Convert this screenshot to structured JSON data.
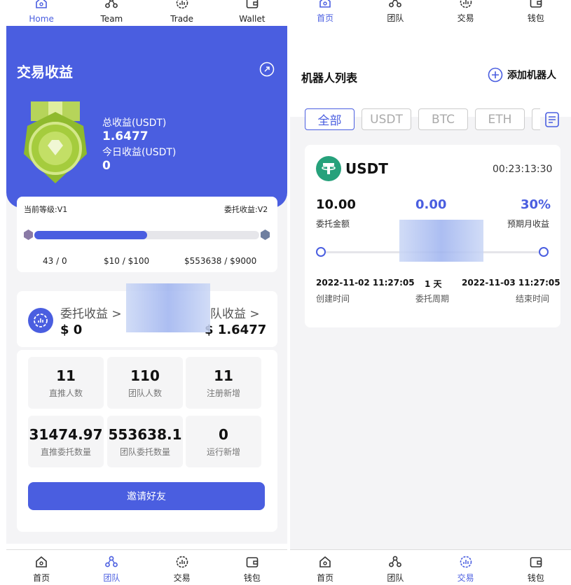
{
  "left": {
    "top_nav": [
      {
        "label": "Home",
        "icon": "home-icon",
        "active": true
      },
      {
        "label": "Team",
        "icon": "team-icon",
        "active": false
      },
      {
        "label": "Trade",
        "icon": "trade-icon",
        "active": false
      },
      {
        "label": "Wallet",
        "icon": "wallet-icon",
        "active": false
      }
    ],
    "hero": {
      "title": "交易收益",
      "total_label": "总收益(USDT)",
      "total_value": "1.6477",
      "today_label": "今日收益(USDT)",
      "today_value": "0"
    },
    "level": {
      "current": "当前等级:V1",
      "commission": "委托收益:V2",
      "progress": 0.5,
      "stats": [
        "43 / 0",
        "$10 / $100",
        "$553638 / $9000"
      ]
    },
    "earnings": {
      "left_label": "委托收益 >",
      "left_value": "$ 0",
      "right_label": "队收益 >",
      "right_value": "$ 1.6477"
    },
    "grid": [
      {
        "value": "11",
        "label": "直推人数"
      },
      {
        "value": "110",
        "label": "团队人数"
      },
      {
        "value": "11",
        "label": "注册新增"
      },
      {
        "value": "31474.97",
        "label": "直推委托数量"
      },
      {
        "value": "553638.1",
        "label": "团队委托数量"
      },
      {
        "value": "0",
        "label": "运行新增"
      }
    ],
    "invite_label": "邀请好友",
    "bottom_nav": [
      {
        "label": "首页",
        "icon": "home-icon",
        "active": false
      },
      {
        "label": "团队",
        "icon": "team-icon",
        "active": true
      },
      {
        "label": "交易",
        "icon": "trade-icon",
        "active": false
      },
      {
        "label": "钱包",
        "icon": "wallet-icon",
        "active": false
      }
    ]
  },
  "right": {
    "top_nav": [
      {
        "label": "首页",
        "icon": "home-icon",
        "active": true
      },
      {
        "label": "团队",
        "icon": "team-icon",
        "active": false
      },
      {
        "label": "交易",
        "icon": "trade-icon",
        "active": false
      },
      {
        "label": "钱包",
        "icon": "wallet-icon",
        "active": false
      }
    ],
    "title": "机器人列表",
    "add_label": "添加机器人",
    "filters": [
      "全部",
      "USDT",
      "BTC",
      "ETH"
    ],
    "robot": {
      "coin": "USDT",
      "time": "00:23:13:30",
      "amount": "10.00",
      "amount_label": "委托金额",
      "profit": "0.00",
      "monthly": "30%",
      "monthly_label": "预期月收益",
      "start": "2022-11-02 11:27:05",
      "start_label": "创建时间",
      "period": "1 天",
      "period_label": "委托周期",
      "end": "2022-11-03 11:27:05",
      "end_label": "结束时间"
    },
    "bottom_nav": [
      {
        "label": "首页",
        "icon": "home-icon",
        "active": false
      },
      {
        "label": "团队",
        "icon": "team-icon",
        "active": false
      },
      {
        "label": "交易",
        "icon": "trade-icon",
        "active": true
      },
      {
        "label": "钱包",
        "icon": "wallet-icon",
        "active": false
      }
    ]
  },
  "colors": {
    "accent": "#4a5ee0",
    "tether": "#26a17b",
    "medal": "#9bc43d"
  }
}
